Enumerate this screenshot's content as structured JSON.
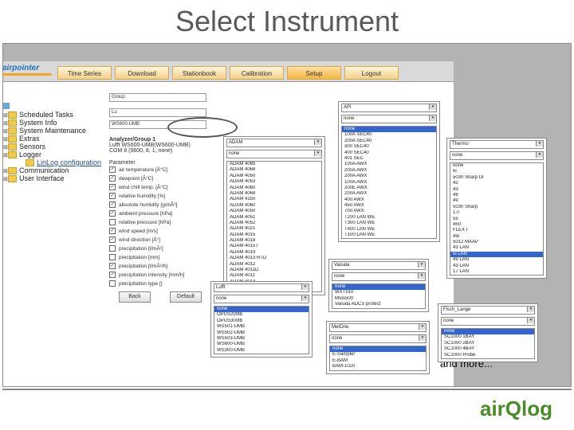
{
  "slide": {
    "title": "Select Instrument",
    "footnote": "and more..."
  },
  "app": {
    "logo": "airpointer",
    "tabs": [
      {
        "label": "Time Series",
        "active": false
      },
      {
        "label": "Download",
        "active": false
      },
      {
        "label": "Stationbook",
        "active": false
      },
      {
        "label": "Calibration",
        "active": false
      },
      {
        "label": "Setup",
        "active": true
      },
      {
        "label": "Logout",
        "active": false
      }
    ],
    "tree": [
      {
        "label": "Scheduled Tasks"
      },
      {
        "label": "System Info"
      },
      {
        "label": "System Maintenance"
      },
      {
        "label": "Extras"
      },
      {
        "label": "Sensors"
      },
      {
        "label": "Logger"
      },
      {
        "label": "LinLog configuration",
        "child": true
      },
      {
        "label": "Communication"
      },
      {
        "label": "User Interface"
      }
    ],
    "settings": {
      "group": "Group",
      "field2": "Lu",
      "field3": "WS600-UMB",
      "analyzer_head": "Analyzer/Group 1",
      "analyzer_line2": "Lufft WS600-UMB(WS600-UMB)",
      "analyzer_line3": "COM 8 (9600, 8, 1, none)",
      "parameters_label": "Parameter",
      "parameters": [
        "air temperature [Â°C]",
        "dewpoint [Â°C]",
        "wind chill temp. [Â°C]",
        "relative humidity [%]",
        "absolute humidity [g/mÂ³]",
        "ambient pressure [hPa]",
        "relative pressure [hPa]",
        "wind speed [m/s]",
        "wind direction [Â°]",
        "precipitation [l/mÂ²]",
        "precipitation [mm]",
        "precipitation [l/mÂ²/h]",
        "precipitation intensity [mm/h]",
        "precipitation type []"
      ],
      "back": "Back",
      "default": "Default"
    }
  },
  "dropdowns": {
    "adam": {
      "selected": "ADAM",
      "second": "none",
      "options": [
        "ADAM 4065",
        "ADAM 4068",
        "ADAM 4050",
        "ADAM 4053",
        "ADAM 4060",
        "ADAM 4068",
        "ADAM 4150",
        "ADAM 4060",
        "ADAM 4050",
        "ADAM 4051",
        "ADAM 4052",
        "ADAM 4021",
        "ADAM 4015",
        "ADAM 4018",
        "ADAM 4015T",
        "ADAM 4019",
        "ADAM 4013 RTD",
        "ADAM 4012",
        "ADAM 4011D",
        "ADAM 4011",
        "ADAM 4013",
        "ADAM 4050"
      ],
      "highlighted": -1
    },
    "api": {
      "selected": "API",
      "second": "none",
      "options": [
        "none",
        "100A SEC40",
        "200A SEC40",
        "300 SEC40",
        "400 SEC40",
        "401 SEC",
        "100A AWX",
        "200A AWX",
        "200A AWX",
        "100A AWX",
        "200E AWX",
        "200A AWX",
        "400 AWX",
        "450 AWX",
        "700 AWX",
        "T200 LAN WE",
        "T300 LAN WE",
        "T400 LAN WE",
        "T100 LAN WE"
      ],
      "highlighted": 0
    },
    "thermo": {
      "selected": "Thermo",
      "second": "none",
      "options": [
        "none",
        "5i",
        "5030 Sharp DI",
        "42",
        "43",
        "48",
        "49",
        "5030 Sharp",
        "17i",
        "55",
        "450",
        "FLEX I",
        "49i",
        "5012 MAAP",
        "43 LAN",
        "5i LAN",
        "49 LAN",
        "43 LAN",
        "17 LAN"
      ],
      "highlighted": 15
    },
    "vaisala": {
      "selected": "Vaisala",
      "second": "none",
      "options": [
        "none",
        "WXT510",
        "MIos500",
        "Vaisala ADCS protect"
      ],
      "highlighted": 0
    },
    "lufft": {
      "selected": "Lufft",
      "second": "none",
      "options": [
        "none",
        "OPUS200tb",
        "OPUS300tb",
        "WS501-UMB",
        "WS502-UMB",
        "WS503-UMB",
        "WS600-UMB",
        "WS300-UMB"
      ],
      "highlighted": 0
    },
    "metone": {
      "selected": "MetOne",
      "second": "none",
      "options": [
        "none",
        "E-Sampler",
        "E-BAM",
        "BAM-1020"
      ],
      "highlighted": 0
    },
    "fischer": {
      "selected": "Fisch_Lange",
      "second": "none",
      "options": [
        "none",
        "SC1000 1BAY",
        "SC1000 2BAY",
        "SC1000 4BAY",
        "SC1000 Probe"
      ],
      "highlighted": 0
    }
  },
  "brand": {
    "text": "airQlog"
  },
  "colors": {
    "accent": "#1e73b8",
    "tab_orange": "#f3b33e",
    "highlight": "#3366cc",
    "brand_green": "#4a8c2a"
  }
}
